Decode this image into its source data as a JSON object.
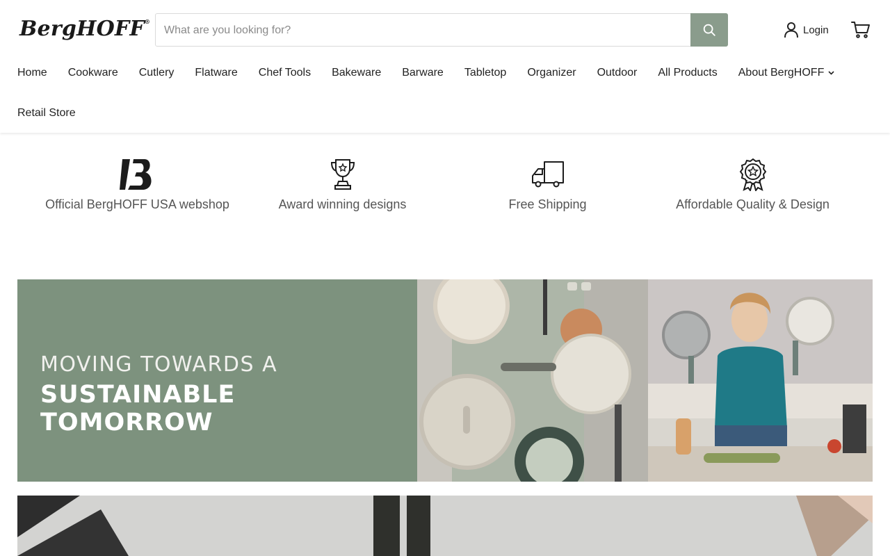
{
  "brand": {
    "logo_text": "BergHOFF",
    "registered_mark": "®"
  },
  "search": {
    "placeholder": "What are you looking for?",
    "value": ""
  },
  "header": {
    "login_label": "Login"
  },
  "nav": {
    "row1": [
      {
        "label": "Home"
      },
      {
        "label": "Cookware"
      },
      {
        "label": "Cutlery"
      },
      {
        "label": "Flatware"
      },
      {
        "label": "Chef Tools"
      },
      {
        "label": "Bakeware"
      },
      {
        "label": "Barware"
      },
      {
        "label": "Tabletop"
      },
      {
        "label": "Organizer"
      },
      {
        "label": "Outdoor"
      },
      {
        "label": "All Products"
      },
      {
        "label": "About BergHOFF"
      }
    ],
    "row2": [
      {
        "label": "Retail Store"
      }
    ]
  },
  "features": [
    {
      "icon": "berghoff-b-logo-icon",
      "text": "Official BergHOFF USA webshop"
    },
    {
      "icon": "trophy-icon",
      "text": "Award winning designs"
    },
    {
      "icon": "delivery-truck-icon",
      "text": "Free Shipping"
    },
    {
      "icon": "award-badge-icon",
      "text": "Affordable Quality & Design"
    }
  ],
  "banner": {
    "line1": "MOVING TOWARDS A",
    "line2": "SUSTAINABLE TOMORROW"
  },
  "colors": {
    "accent": "#8a9c8c",
    "banner_green": "#7d927e",
    "text": "#222222",
    "muted_text": "#555555"
  }
}
